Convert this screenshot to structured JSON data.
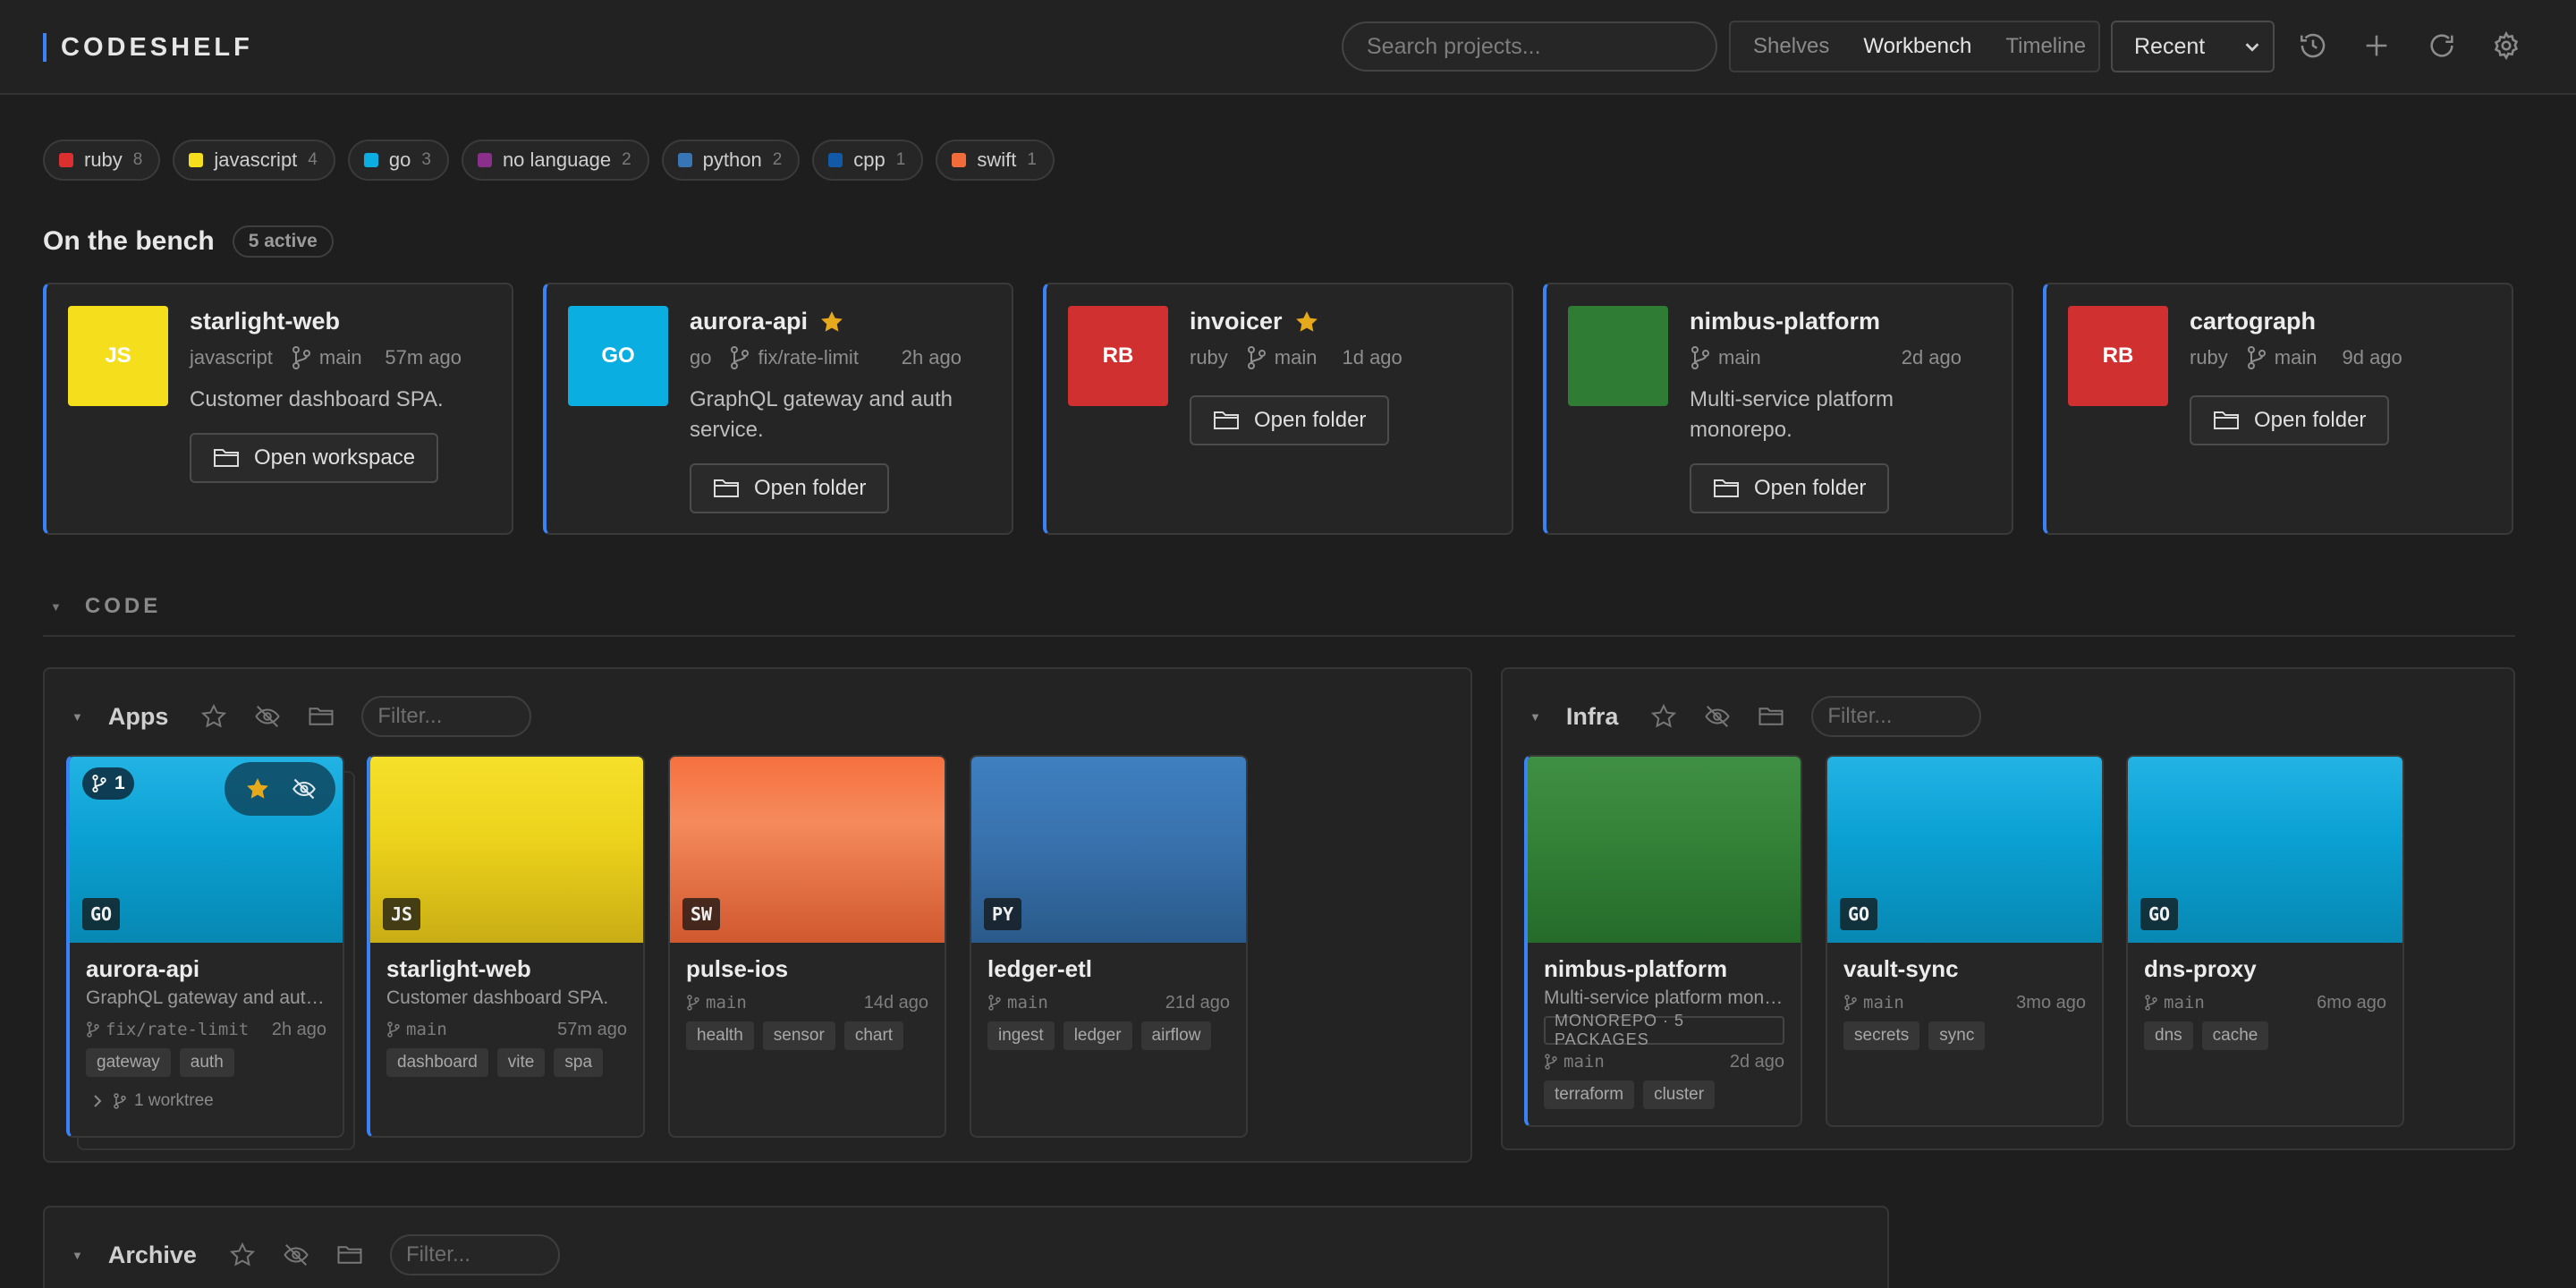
{
  "app": {
    "title": "CODESHELF"
  },
  "search": {
    "placeholder": "Search projects..."
  },
  "view_tabs": [
    "Shelves",
    "Workbench",
    "Timeline"
  ],
  "active_view": "Workbench",
  "sort": {
    "selected": "Recent"
  },
  "toolbar_icons": [
    "history-icon",
    "plus-icon",
    "refresh-icon",
    "gear-icon"
  ],
  "languages": [
    {
      "name": "ruby",
      "count": "8",
      "color": "#dc2f2f"
    },
    {
      "name": "javascript",
      "count": "4",
      "color": "#f5df1d"
    },
    {
      "name": "go",
      "count": "3",
      "color": "#0aaee0"
    },
    {
      "name": "no language",
      "count": "2",
      "color": "#8a2f8a"
    },
    {
      "name": "python",
      "count": "2",
      "color": "#3775b5"
    },
    {
      "name": "cpp",
      "count": "1",
      "color": "#115aa8"
    },
    {
      "name": "swift",
      "count": "1",
      "color": "#f26b3a"
    }
  ],
  "bench": {
    "title": "On the bench",
    "badge": "5 active",
    "cards": [
      {
        "thumb": "JS",
        "color": "#f5df1d",
        "name": "starlight-web",
        "starred": false,
        "lang": "javascript",
        "branch": "main",
        "time": "57m ago",
        "desc": "Customer dashboard SPA.",
        "action": "Open workspace"
      },
      {
        "thumb": "GO",
        "color": "#0aaee0",
        "name": "aurora-api",
        "starred": true,
        "lang": "go",
        "branch": "fix/rate-limit",
        "time": "2h ago",
        "desc": "GraphQL gateway and auth service.",
        "action": "Open folder"
      },
      {
        "thumb": "RB",
        "color": "#d13030",
        "name": "invoicer",
        "starred": true,
        "lang": "ruby",
        "branch": "main",
        "time": "1d ago",
        "desc": "",
        "action": "Open folder"
      },
      {
        "thumb": "",
        "color": "#2f7d34",
        "name": "nimbus-platform",
        "starred": false,
        "lang": "",
        "branch": "main",
        "time": "2d ago",
        "desc": "Multi-service platform monorepo.",
        "action": "Open folder"
      },
      {
        "thumb": "RB",
        "color": "#d13030",
        "name": "cartograph",
        "starred": false,
        "lang": "ruby",
        "branch": "main",
        "time": "9d ago",
        "desc": "",
        "action": "Open folder"
      }
    ]
  },
  "code_section": {
    "title": "CODE"
  },
  "shelves": {
    "apps": {
      "name": "Apps",
      "filter_placeholder": "Filter...",
      "cards": [
        {
          "badge": "GO",
          "name": "aurora-api",
          "desc": "GraphQL gateway and auth service.",
          "branch": "fix/rate-limit",
          "time": "2h ago",
          "tags": [
            "gateway",
            "auth"
          ],
          "worktree_count": "1",
          "worktree_label": "1 worktree",
          "starred": true
        },
        {
          "badge": "JS",
          "name": "starlight-web",
          "desc": "Customer dashboard SPA.",
          "branch": "main",
          "time": "57m ago",
          "tags": [
            "dashboard",
            "vite",
            "spa"
          ]
        },
        {
          "badge": "SW",
          "name": "pulse-ios",
          "desc": "",
          "branch": "main",
          "time": "14d ago",
          "tags": [
            "health",
            "sensor",
            "chart"
          ]
        },
        {
          "badge": "PY",
          "name": "ledger-etl",
          "desc": "",
          "branch": "main",
          "time": "21d ago",
          "tags": [
            "ingest",
            "ledger",
            "airflow"
          ]
        }
      ]
    },
    "infra": {
      "name": "Infra",
      "filter_placeholder": "Filter...",
      "cards": [
        {
          "badge": "",
          "name": "nimbus-platform",
          "desc": "Multi-service platform monorepo.",
          "mono_tag": "MONOREPO · 5 PACKAGES",
          "branch": "main",
          "time": "2d ago",
          "tags": [
            "terraform",
            "cluster"
          ]
        },
        {
          "badge": "GO",
          "name": "vault-sync",
          "desc": "",
          "branch": "main",
          "time": "3mo ago",
          "tags": [
            "secrets",
            "sync"
          ]
        },
        {
          "badge": "GO",
          "name": "dns-proxy",
          "desc": "",
          "branch": "main",
          "time": "6mo ago",
          "tags": [
            "dns",
            "cache"
          ]
        }
      ]
    },
    "archive": {
      "name": "Archive",
      "filter_placeholder": "Filter..."
    }
  }
}
